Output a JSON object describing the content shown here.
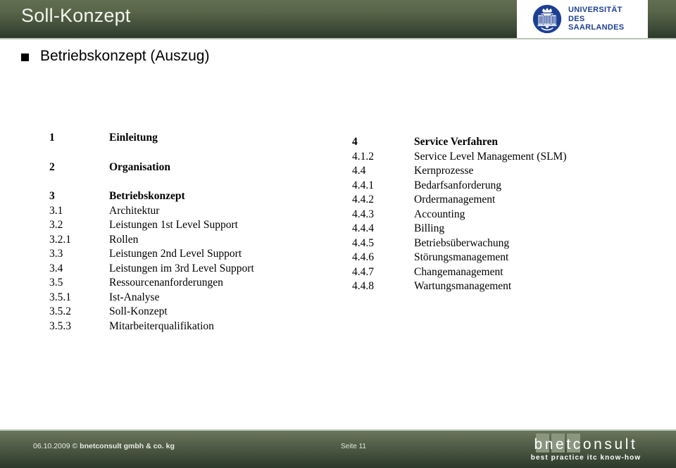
{
  "header": {
    "title": "Soll-Konzept",
    "logo": {
      "line1": "UNIVERSITÄT",
      "line2": "DES",
      "line3": "SAARLANDES",
      "seal_icon": "university-seal-icon",
      "brand_color": "#1c3f94"
    },
    "band_color_top": "#626e52",
    "band_color_bottom": "#2a3729"
  },
  "slide": {
    "bullet_icon": "square-bullet-icon",
    "bullet_text": "Betriebskonzept (Auszug)"
  },
  "toc": {
    "left": [
      {
        "num": "1",
        "label": "Einleitung",
        "major": true,
        "gap": false
      },
      {
        "num": "2",
        "label": "Organisation",
        "major": true,
        "gap": true
      },
      {
        "num": "3",
        "label": "Betriebskonzept",
        "major": true,
        "gap": true
      },
      {
        "num": "3.1",
        "label": "Architektur",
        "major": false,
        "gap": false
      },
      {
        "num": "3.2",
        "label": "Leistungen 1st Level Support",
        "major": false,
        "gap": false
      },
      {
        "num": "3.2.1",
        "label": "Rollen",
        "major": false,
        "gap": false
      },
      {
        "num": "3.3",
        "label": "Leistungen 2nd Level Support",
        "major": false,
        "gap": false
      },
      {
        "num": "3.4",
        "label": "Leistungen im 3rd Level Support",
        "major": false,
        "gap": false
      },
      {
        "num": "3.5",
        "label": "Ressourcenanforderungen",
        "major": false,
        "gap": false
      },
      {
        "num": "3.5.1",
        "label": "Ist-Analyse",
        "major": false,
        "gap": false
      },
      {
        "num": "3.5.2",
        "label": "Soll-Konzept",
        "major": false,
        "gap": false
      },
      {
        "num": "3.5.3",
        "label": "Mitarbeiterqualifikation",
        "major": false,
        "gap": false
      }
    ],
    "right": [
      {
        "num": "4",
        "label": "Service Verfahren",
        "major": true,
        "gap": false
      },
      {
        "num": "4.1.2",
        "label": "Service Level Management (SLM)",
        "major": false,
        "gap": false
      },
      {
        "num": "4.4",
        "label": "Kernprozesse",
        "major": false,
        "gap": false
      },
      {
        "num": "4.4.1",
        "label": "Bedarfsanforderung",
        "major": false,
        "gap": false
      },
      {
        "num": "4.4.2",
        "label": "Ordermanagement",
        "major": false,
        "gap": false
      },
      {
        "num": "4.4.3",
        "label": "Accounting",
        "major": false,
        "gap": false
      },
      {
        "num": "4.4.4",
        "label": "Billing",
        "major": false,
        "gap": false
      },
      {
        "num": "4.4.5",
        "label": "Betriebsüberwachung",
        "major": false,
        "gap": false
      },
      {
        "num": "4.4.6",
        "label": "Störungsmanagement",
        "major": false,
        "gap": false
      },
      {
        "num": "4.4.7",
        "label": "Changemanagement",
        "major": false,
        "gap": false
      },
      {
        "num": "4.4.8",
        "label": "Wartungsmanagement",
        "major": false,
        "gap": false
      }
    ]
  },
  "footer": {
    "date": "06.10.2009",
    "copyright_symbol": "©",
    "company": "bnetconsult gmbh & co. kg",
    "page_label": "Seite 11",
    "logo": {
      "word": "bnetconsult",
      "tagline": "best practice itc know-how",
      "highlight_letters": "net"
    }
  }
}
